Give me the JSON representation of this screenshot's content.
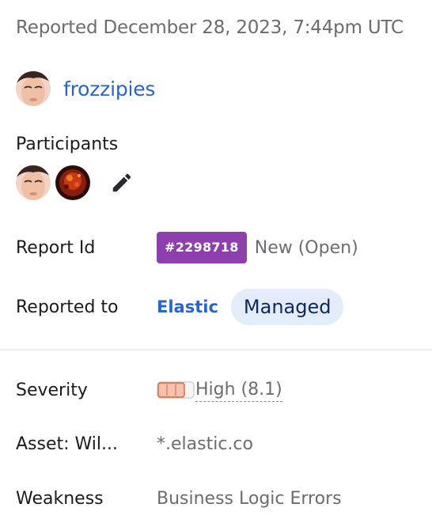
{
  "reported": {
    "text": "Reported December 28, 2023, 7:44pm UTC"
  },
  "reporter": {
    "username": "frozzipies",
    "avatar_icon": "user-avatar-face"
  },
  "participants": {
    "label": "Participants",
    "avatars": [
      "user-avatar-face",
      "user-avatar-red"
    ],
    "edit_icon": "pencil-icon"
  },
  "report": {
    "id_label": "Report Id",
    "id": "#2298718",
    "state": "New (Open)"
  },
  "reported_to": {
    "label": "Reported to",
    "program": "Elastic",
    "badge": "Managed"
  },
  "severity": {
    "label": "Severity",
    "value": "High (8.1)",
    "level_segments_filled": 3,
    "level_segments_total": 4,
    "color": "#e0633b"
  },
  "asset": {
    "label": "Asset: Wil...",
    "value": "*.elastic.co"
  },
  "weakness": {
    "label": "Weakness",
    "value": "Business Logic Errors"
  },
  "colors": {
    "link": "#2563d6",
    "report_id_badge": "#8e3fae",
    "managed_pill_bg": "#e3ecfb",
    "muted_text": "#6b6b74"
  }
}
